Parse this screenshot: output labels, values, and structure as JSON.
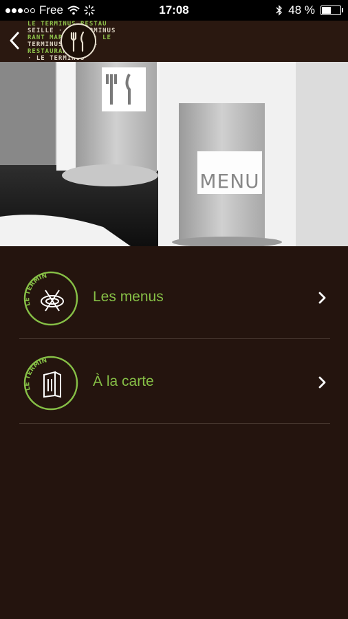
{
  "status_bar": {
    "carrier": "Free",
    "time": "17:08",
    "battery": "48 %",
    "battery_level": 0.48
  },
  "nav": {
    "logo_text_lines": [
      "LE TERMINUS RESTAU",
      "SEILLE · LE TERMINUS",
      "RANT MARSEILLE · LE",
      "TERMINUS RESTAU-",
      "RESTAURANT MAR-",
      "· LE TERMINUS"
    ]
  },
  "hero": {
    "sign_text": "MENU"
  },
  "menu_items": [
    {
      "label": "Les menus",
      "badge_text": "LE TERMINUS",
      "icon": "utensils-plate-icon"
    },
    {
      "label": "À la carte",
      "badge_text": "LE TERMINUS",
      "icon": "menu-card-icon"
    }
  ],
  "colors": {
    "background": "#24140e",
    "accent_green": "#86bf46",
    "divider": "#4a3a32"
  }
}
